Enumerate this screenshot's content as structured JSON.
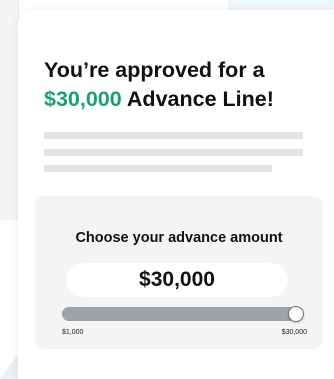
{
  "offer": {
    "headline_line1": "You’re approved for a",
    "headline_amount": "$30,000",
    "headline_suffix": "Advance Line!"
  },
  "advance_selector": {
    "title": "Choose your advance amount",
    "selected_amount": "$30,000",
    "slider": {
      "min_label": "$1,000",
      "max_label": "$30,000",
      "min_value": 1000,
      "max_value": 30000,
      "value": 30000
    }
  },
  "colors": {
    "accent_green": "#1aa16f",
    "text": "#111111",
    "panel_bg": "#f3f4f6",
    "track": "#9ea3a8",
    "placeholder": "#e2e4e6"
  }
}
